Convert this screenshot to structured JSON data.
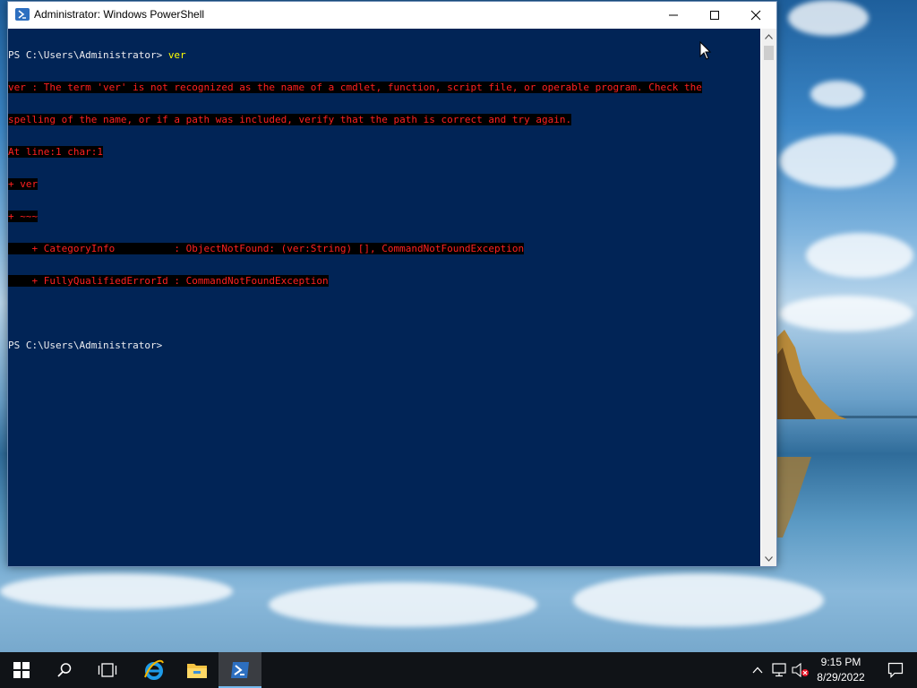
{
  "window": {
    "title": "Administrator: Windows PowerShell"
  },
  "console": {
    "lines": [
      {
        "type": "prompt",
        "prompt": "PS C:\\Users\\Administrator> ",
        "command": "ver"
      },
      {
        "type": "error",
        "text": "ver : The term 'ver' is not recognized as the name of a cmdlet, function, script file, or operable program. Check the"
      },
      {
        "type": "error",
        "text": "spelling of the name, or if a path was included, verify that the path is correct and try again."
      },
      {
        "type": "error",
        "text": "At line:1 char:1"
      },
      {
        "type": "error",
        "text": "+ ver"
      },
      {
        "type": "error",
        "text": "+ ~~~"
      },
      {
        "type": "error",
        "text": "    + CategoryInfo          : ObjectNotFound: (ver:String) [], CommandNotFoundException"
      },
      {
        "type": "error",
        "text": "    + FullyQualifiedErrorId : CommandNotFoundException"
      },
      {
        "type": "blank",
        "text": ""
      },
      {
        "type": "prompt",
        "prompt": "PS C:\\Users\\Administrator>",
        "command": ""
      }
    ],
    "colors": {
      "background": "#012456",
      "error_text": "#ff2020",
      "command_text": "#ffff00"
    }
  },
  "taskbar": {
    "pinned": [
      "start-icon",
      "search-icon",
      "task-view-icon",
      "internet-explorer-icon",
      "file-explorer-icon",
      "powershell-icon"
    ],
    "clock": {
      "time": "9:15 PM",
      "date": "8/29/2022"
    }
  }
}
